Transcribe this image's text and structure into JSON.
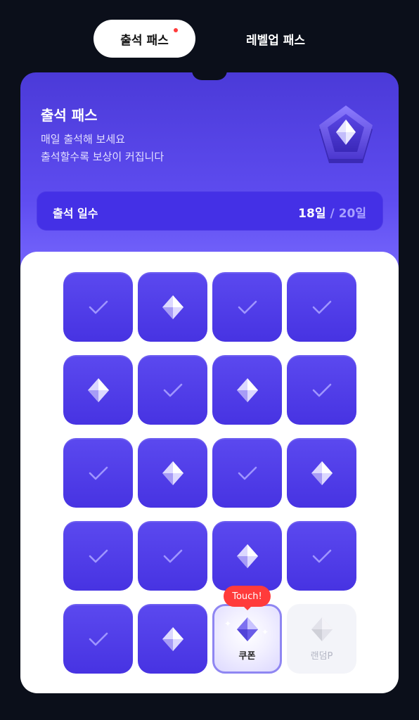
{
  "tabs": {
    "active_label": "출석 패스",
    "inactive_label": "레벨업 패스"
  },
  "hero": {
    "title": "출석 패스",
    "subtitle_line1": "매일 출석해 보세요",
    "subtitle_line2": "출석할수록 보상이 커집니다"
  },
  "attendance": {
    "label": "출석 일수",
    "current": "18일",
    "separator": "/",
    "total": "20일"
  },
  "tiles": [
    {
      "state": "check"
    },
    {
      "state": "gem"
    },
    {
      "state": "check"
    },
    {
      "state": "check"
    },
    {
      "state": "gem"
    },
    {
      "state": "check"
    },
    {
      "state": "gem"
    },
    {
      "state": "check"
    },
    {
      "state": "check"
    },
    {
      "state": "gem"
    },
    {
      "state": "check"
    },
    {
      "state": "gem"
    },
    {
      "state": "check"
    },
    {
      "state": "check"
    },
    {
      "state": "gem"
    },
    {
      "state": "check"
    },
    {
      "state": "check"
    },
    {
      "state": "gem"
    },
    {
      "state": "coupon",
      "label": "쿠폰"
    },
    {
      "state": "random",
      "label": "랜덤P"
    }
  ],
  "touch_tooltip": "Touch!",
  "colors": {
    "accent": "#4b3ad8",
    "tile": "#5240ea",
    "alert": "#ff3b3b"
  },
  "icons": {
    "check": "checkmark-icon",
    "gem": "diamond-icon",
    "badge": "diamond-badge-icon"
  }
}
